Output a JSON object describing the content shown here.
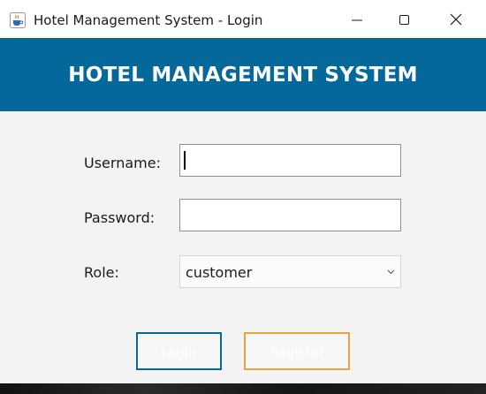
{
  "window": {
    "title": "Hotel Management System - Login",
    "app_icon": "java-cup-icon",
    "controls": [
      "minimize-icon",
      "maximize-icon",
      "close-icon"
    ]
  },
  "header": {
    "title": "HOTEL MANAGEMENT SYSTEM",
    "background_color": "#05689a"
  },
  "form": {
    "username": {
      "label": "Username:",
      "value": ""
    },
    "password": {
      "label": "Password:",
      "value": ""
    },
    "role": {
      "label": "Role:",
      "selected": "customer"
    }
  },
  "buttons": {
    "login": {
      "label": "Login",
      "border_color": "#05689a"
    },
    "register": {
      "label": "Register",
      "border_color": "#e8a33d"
    }
  }
}
